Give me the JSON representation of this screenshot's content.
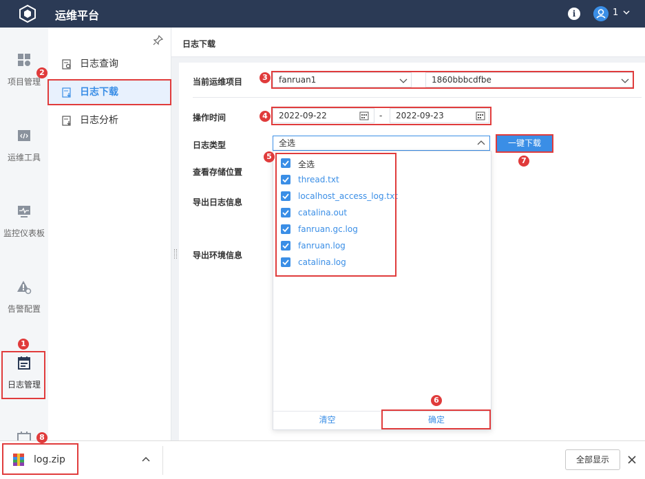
{
  "topbar": {
    "title": "运维平台",
    "user": "1"
  },
  "leftnav": {
    "items": [
      {
        "label": "项目管理",
        "icon": "grid-icon"
      },
      {
        "label": "运维工具",
        "icon": "code-window-icon"
      },
      {
        "label": "监控仪表板",
        "icon": "monitor-icon"
      },
      {
        "label": "告警配置",
        "icon": "alert-gear-icon"
      },
      {
        "label": "日志管理",
        "icon": "calendar-log-icon"
      }
    ]
  },
  "subnav": {
    "items": [
      {
        "label": "日志查询",
        "active": false
      },
      {
        "label": "日志下载",
        "active": true
      },
      {
        "label": "日志分析",
        "active": false
      }
    ]
  },
  "page": {
    "title": "日志下载"
  },
  "form": {
    "project_label": "当前运维项目",
    "project_value": "fanruan1",
    "project_id": "1860bbbcdfbe",
    "time_label": "操作时间",
    "date_start": "2022-09-22",
    "date_sep": "-",
    "date_end": "2022-09-23",
    "logtype_label": "日志类型",
    "logtype_value": "全选",
    "oneclick_label": "一键下载",
    "storage_label": "查看存储位置",
    "export_log_label": "导出日志信息",
    "export_env_label": "导出环境信息"
  },
  "dropdown": {
    "options": [
      "全选",
      "thread.txt",
      "localhost_access_log.txt",
      "catalina.out",
      "fanruan.gc.log",
      "fanruan.log",
      "catalina.log"
    ],
    "clear_label": "清空",
    "confirm_label": "确定"
  },
  "badges": [
    "1",
    "2",
    "3",
    "4",
    "5",
    "6",
    "7",
    "8"
  ],
  "downloads": {
    "file_name": "log.zip",
    "show_all_label": "全部显示"
  },
  "colors": {
    "accent": "#3a8ee6",
    "topbar": "#2b3a55",
    "annotation": "#e03b3b"
  }
}
